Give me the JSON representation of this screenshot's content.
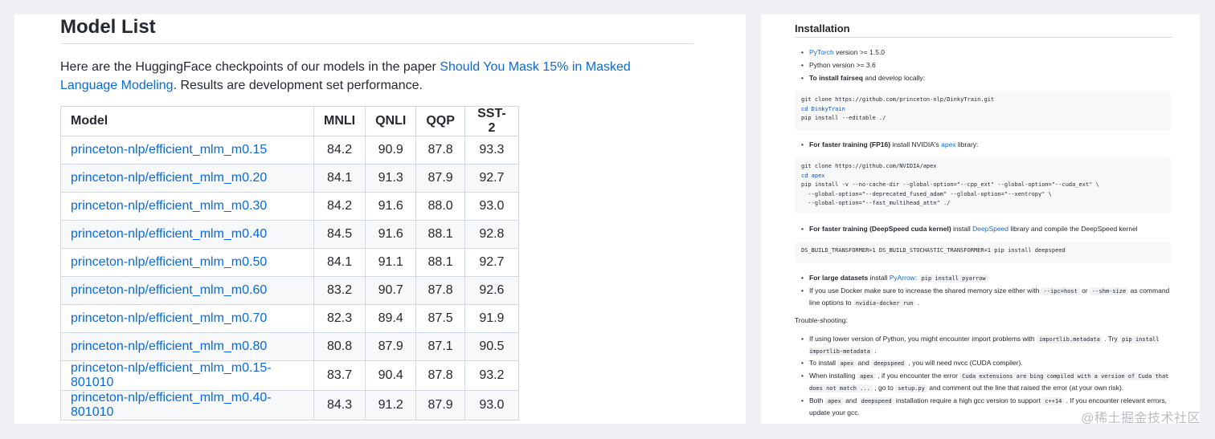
{
  "left": {
    "title": "Model List",
    "intro_before": "Here are the HuggingFace checkpoints of our models in the paper ",
    "intro_link": "Should You Mask 15% in Masked Language Modeling",
    "intro_after": ". Results are development set performance.",
    "table": {
      "headers": [
        "Model",
        "MNLI",
        "QNLI",
        "QQP",
        "SST-2"
      ],
      "rows": [
        {
          "model": "princeton-nlp/efficient_mlm_m0.15",
          "mnli": "84.2",
          "qnli": "90.9",
          "qqp": "87.8",
          "sst2": "93.3"
        },
        {
          "model": "princeton-nlp/efficient_mlm_m0.20",
          "mnli": "84.1",
          "qnli": "91.3",
          "qqp": "87.9",
          "sst2": "92.7"
        },
        {
          "model": "princeton-nlp/efficient_mlm_m0.30",
          "mnli": "84.2",
          "qnli": "91.6",
          "qqp": "88.0",
          "sst2": "93.0"
        },
        {
          "model": "princeton-nlp/efficient_mlm_m0.40",
          "mnli": "84.5",
          "qnli": "91.6",
          "qqp": "88.1",
          "sst2": "92.8"
        },
        {
          "model": "princeton-nlp/efficient_mlm_m0.50",
          "mnli": "84.1",
          "qnli": "91.1",
          "qqp": "88.1",
          "sst2": "92.7"
        },
        {
          "model": "princeton-nlp/efficient_mlm_m0.60",
          "mnli": "83.2",
          "qnli": "90.7",
          "qqp": "87.8",
          "sst2": "92.6"
        },
        {
          "model": "princeton-nlp/efficient_mlm_m0.70",
          "mnli": "82.3",
          "qnli": "89.4",
          "qqp": "87.5",
          "sst2": "91.9"
        },
        {
          "model": "princeton-nlp/efficient_mlm_m0.80",
          "mnli": "80.8",
          "qnli": "87.9",
          "qqp": "87.1",
          "sst2": "90.5"
        },
        {
          "model": "princeton-nlp/efficient_mlm_m0.15-801010",
          "mnli": "83.7",
          "qnli": "90.4",
          "qqp": "87.8",
          "sst2": "93.2"
        },
        {
          "model": "princeton-nlp/efficient_mlm_m0.40-801010",
          "mnli": "84.3",
          "qnli": "91.2",
          "qqp": "87.9",
          "sst2": "93.0"
        }
      ]
    }
  },
  "right": {
    "title": "Installation",
    "req_pytorch_link": "PyTorch",
    "req_pytorch_text": " version >= 1.5.0",
    "req_python": "Python version >= 3.6",
    "req_fairseq_bold": "To install fairseq",
    "req_fairseq_text": " and develop locally:",
    "code1": [
      "git clone https://github.com/princeton-nlp/DinkyTrain.git",
      "cd DinkyTrain",
      "pip install --editable ./"
    ],
    "apex_bold": "For faster training (FP16)",
    "apex_text1": " install NVIDIA's ",
    "apex_link": "apex",
    "apex_text2": " library:",
    "code2": [
      "git clone https://github.com/NVIDIA/apex",
      "cd apex",
      "pip install -v --no-cache-dir --global-option=\"--cpp_ext\" --global-option=\"--cuda_ext\" \\",
      "  --global-option=\"--deprecated_fused_adam\" --global-option=\"--xentropy\" \\",
      "  --global-option=\"--fast_multihead_attn\" ./"
    ],
    "ds_bold": "For faster training (DeepSpeed cuda kernel)",
    "ds_text1": " install ",
    "ds_link": "DeepSpeed",
    "ds_text2": " library and compile the DeepSpeed kernel",
    "code3": "DS_BUILD_TRANSFORMER=1 DS_BUILD_STOCHASTIC_TRANSFORMER=1 pip install deepspeed",
    "pa_bold": "For large datasets",
    "pa_text1": " install ",
    "pa_link": "PyArrow",
    "pa_text2": ": ",
    "pa_code": "pip install pyarrow",
    "docker_text1": "If you use Docker make sure to increase the shared memory size either with ",
    "docker_code1": "--ipc=host",
    "docker_text2": " or ",
    "docker_code2": "--shm-size",
    "docker_text3": " as command line options to ",
    "docker_code3": "nvidia-docker run",
    "docker_text4": " .",
    "ts_title": "Trouble-shooting:",
    "ts1_text1": "If using lower version of Python, you might encounter import problems with ",
    "ts1_code1": "importlib.metadata",
    "ts1_text2": " . Try ",
    "ts1_code2": "pip install importlib-metadata",
    "ts1_text3": " .",
    "ts2_text1": "To install ",
    "ts2_code1": "apex",
    "ts2_text2": " and ",
    "ts2_code2": "deepspeed",
    "ts2_text3": " , you will need nvcc (CUDA compiler).",
    "ts3_text1": "When installing ",
    "ts3_code1": "apex",
    "ts3_text2": " , if you encounter the error ",
    "ts3_code2": "Cuda extensions are bing compiled with a version of Cuda that does not match ...",
    "ts3_text3": " , go to ",
    "ts3_code3": "setup.py",
    "ts3_text4": " and comment out the line that raised the error (at your own risk).",
    "ts4_text1": "Both ",
    "ts4_code1": "apex",
    "ts4_text2": " and ",
    "ts4_code2": "deepspeed",
    "ts4_text3": " installation require a high gcc version to support ",
    "ts4_code3": "c++14",
    "ts4_text4": " . If you encounter relevant errors, update your gcc."
  },
  "watermark": "@稀土掘金技术社区"
}
